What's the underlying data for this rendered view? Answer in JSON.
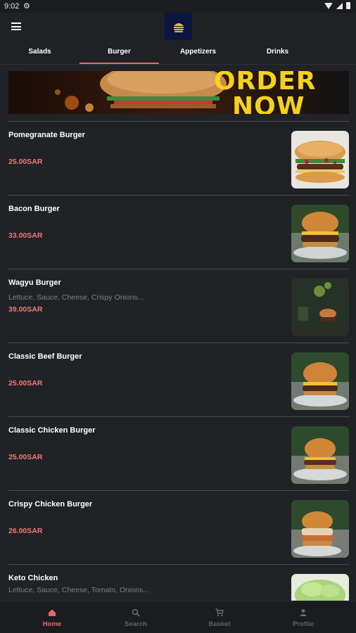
{
  "status_bar": {
    "time": "9:02"
  },
  "tabs": [
    {
      "label": "Salads"
    },
    {
      "label": "Burger"
    },
    {
      "label": "Appetizers"
    },
    {
      "label": "Drinks"
    }
  ],
  "active_tab": "Burger",
  "banner": {
    "text_line1": "ORDER",
    "text_line2": "NOW"
  },
  "items": [
    {
      "name": "Pomegranate Burger",
      "description": "",
      "price": "25.00SAR"
    },
    {
      "name": "Bacon Burger",
      "description": "",
      "price": "33.00SAR"
    },
    {
      "name": "Wagyu Burger",
      "description": "Lettuce, Sauce, Cheese, Crispy Onions...",
      "price": "39.00SAR"
    },
    {
      "name": "Classic Beef Burger",
      "description": "",
      "price": "25.00SAR"
    },
    {
      "name": "Classic Chicken Burger",
      "description": "",
      "price": "25.00SAR"
    },
    {
      "name": "Crispy Chicken Burger",
      "description": "",
      "price": "26.00SAR"
    },
    {
      "name": "Keto Chicken",
      "description": "Lettuce, Sauce, Cheese, Tomato, Onions...",
      "price": ""
    }
  ],
  "bottom_nav": [
    {
      "label": "Home",
      "icon": "home-icon"
    },
    {
      "label": "Search",
      "icon": "search-icon"
    },
    {
      "label": "Basket",
      "icon": "cart-icon"
    },
    {
      "label": "Profile",
      "icon": "profile-icon"
    }
  ],
  "colors": {
    "accent": "#e46a6d",
    "price": "#f07a7c",
    "background": "#202226"
  }
}
